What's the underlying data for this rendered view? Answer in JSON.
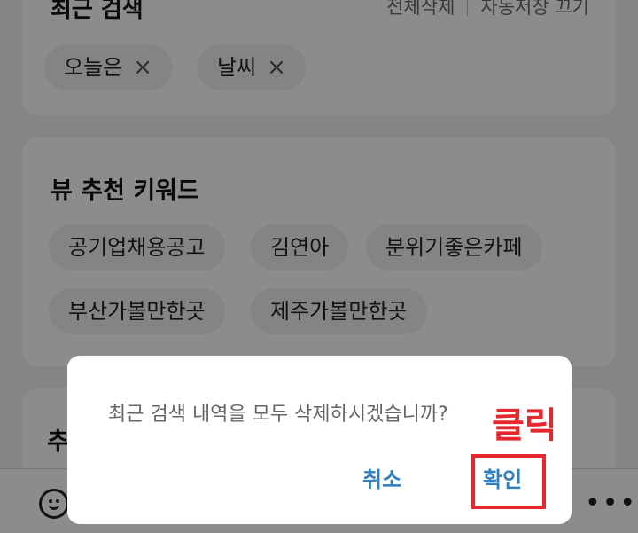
{
  "recent_search": {
    "title": "최근 검색",
    "delete_all_label": "전체삭제",
    "autosave_label": "자동저장 끄기",
    "chips": [
      {
        "label": "오늘은",
        "close_icon": "×"
      },
      {
        "label": "날씨",
        "close_icon": "×"
      }
    ]
  },
  "view_keywords": {
    "title": "뷰 추천 키워드",
    "chips": [
      "공기업채용공고",
      "김연아",
      "분위기좋은카페",
      "부산가볼만한곳",
      "제주가볼만한곳"
    ]
  },
  "third_section": {
    "title_fragment": "추"
  },
  "bottom_bar": {
    "icons": [
      "emoji-icon",
      "more-icon"
    ],
    "more_glyph": "•••"
  },
  "dialog": {
    "message": "최근 검색 내역을 모두 삭제하시겠습니까?",
    "cancel_label": "취소",
    "confirm_label": "확인"
  },
  "annotation": {
    "label": "클릭",
    "color": "#e8262d"
  },
  "colors": {
    "accent": "#2f7fc1",
    "annotation": "#e8262d",
    "chip_bg": "#eef0f2"
  }
}
